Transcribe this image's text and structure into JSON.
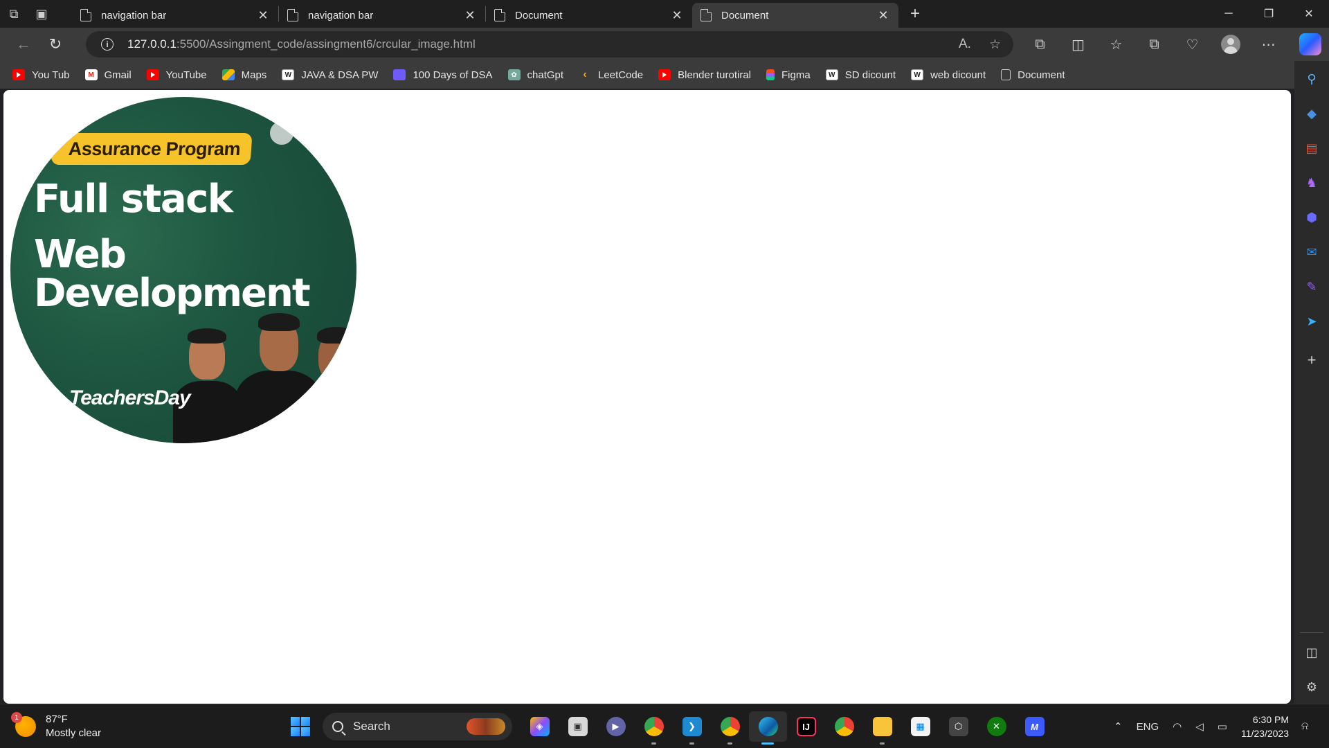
{
  "tabs": [
    {
      "title": "navigation bar",
      "active": false
    },
    {
      "title": "navigation bar",
      "active": false
    },
    {
      "title": "Document",
      "active": false
    },
    {
      "title": "Document",
      "active": true
    }
  ],
  "address": {
    "url_host": "127.0.0.1",
    "url_rest": ":5500/Assingment_code/assingment6/crcular_image.html"
  },
  "bookmarks": [
    {
      "label": "You Tub",
      "icon": "youtube-icon"
    },
    {
      "label": "Gmail",
      "icon": "gmail-icon"
    },
    {
      "label": "YouTube",
      "icon": "youtube-icon"
    },
    {
      "label": "Maps",
      "icon": "maps-icon"
    },
    {
      "label": "JAVA & DSA  PW",
      "icon": "pw-icon"
    },
    {
      "label": "100 Days of DSA",
      "icon": "calendar-icon"
    },
    {
      "label": "chatGpt",
      "icon": "chatgpt-icon"
    },
    {
      "label": "LeetCode",
      "icon": "leetcode-icon"
    },
    {
      "label": "Blender turotiral",
      "icon": "youtube-icon"
    },
    {
      "label": "Figma",
      "icon": "figma-icon"
    },
    {
      "label": "SD dicount",
      "icon": "pw-icon"
    },
    {
      "label": "web dicount",
      "icon": "pw-icon"
    },
    {
      "label": "Document",
      "icon": "document-icon"
    }
  ],
  "page": {
    "image": {
      "pill": "Assurance Program",
      "heading_line1": "Full stack",
      "heading_line2": "Web Development",
      "hashtag": "TeachersDay"
    }
  },
  "taskbar": {
    "weather_badge": "1",
    "temperature": "87°F",
    "condition": "Mostly clear",
    "search_label": "Search",
    "language": "ENG",
    "time": "6:30 PM",
    "date": "11/23/2023"
  },
  "colors": {
    "accent": "#4cc2ff",
    "image_green": "#1d5540",
    "pill_yellow": "#f6c32a"
  }
}
